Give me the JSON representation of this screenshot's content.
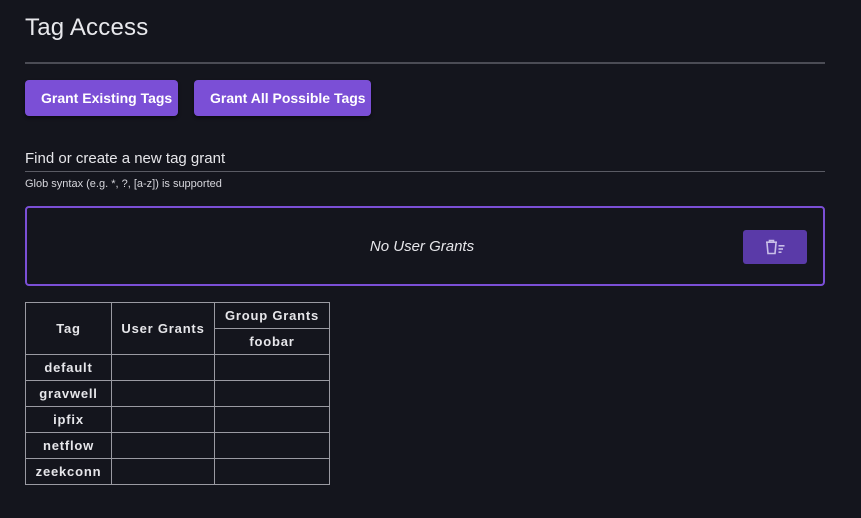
{
  "page": {
    "title": "Tag Access"
  },
  "actions": {
    "grant_existing_label": "Grant Existing Tags",
    "grant_all_label": "Grant All Possible Tags"
  },
  "search": {
    "placeholder": "Find or create a new tag grant",
    "value": "",
    "hint": "Glob syntax (e.g. *, ?, [a-z]) is supported"
  },
  "user_grants": {
    "empty_text": "No User Grants",
    "clear_icon": "clear-list-icon"
  },
  "colors": {
    "accent": "#7b4fd6",
    "clear_button": "#5a3aa8",
    "background": "#14151d"
  },
  "table": {
    "headers": {
      "tag": "Tag",
      "user_grants": "User Grants",
      "group_grants": "Group Grants"
    },
    "groups": [
      "foobar"
    ],
    "rows": [
      {
        "tag": "default",
        "user": "",
        "foobar": ""
      },
      {
        "tag": "gravwell",
        "user": "",
        "foobar": ""
      },
      {
        "tag": "ipfix",
        "user": "",
        "foobar": ""
      },
      {
        "tag": "netflow",
        "user": "",
        "foobar": ""
      },
      {
        "tag": "zeekconn",
        "user": "",
        "foobar": ""
      }
    ]
  }
}
